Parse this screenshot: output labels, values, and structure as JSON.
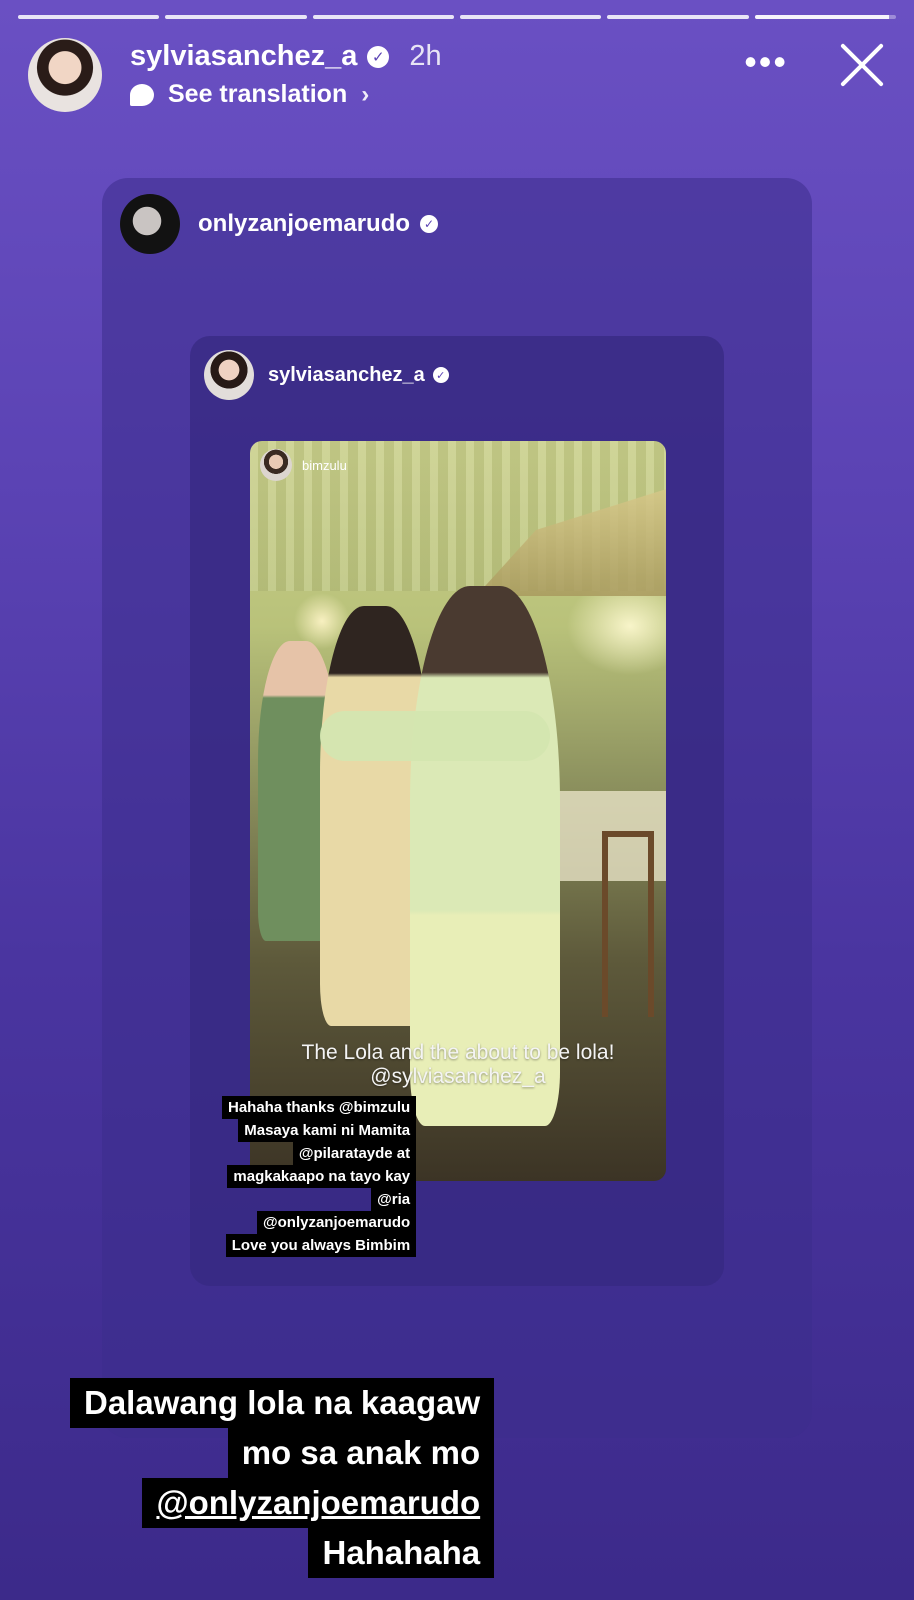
{
  "progress": {
    "segments": 6,
    "complete": 5,
    "current_fraction": 0.95
  },
  "header": {
    "username": "sylviasanchez_a",
    "time": "2h",
    "translate_label": "See translation",
    "more_icon": "more-icon",
    "close_icon": "close-icon"
  },
  "outer_card": {
    "username": "onlyzanjoemarudo"
  },
  "inner_card": {
    "username": "sylviasanchez_a",
    "photo": {
      "username": "bimzulu",
      "caption_line1": "The Lola and the about to be lola!",
      "caption_line2": "@sylviasanchez_a"
    },
    "text_lines": [
      "Hahaha thanks @bimzulu",
      "Masaya  kami ni Mamita",
      "@pilaratayde at",
      "magkakaapo na tayo kay",
      "@ria",
      "@onlyzanjoemarudo",
      "Love you always Bimbim"
    ]
  },
  "story_text": {
    "line1": "Dalawang lola na kaagaw",
    "line2": "mo sa anak mo",
    "line3": "@onlyzanjoemarudo",
    "line4": "Hahahaha"
  },
  "colors": {
    "background_top": "#6a50c3",
    "background_bottom": "#3c2a8a",
    "text_bg": "#000000"
  }
}
